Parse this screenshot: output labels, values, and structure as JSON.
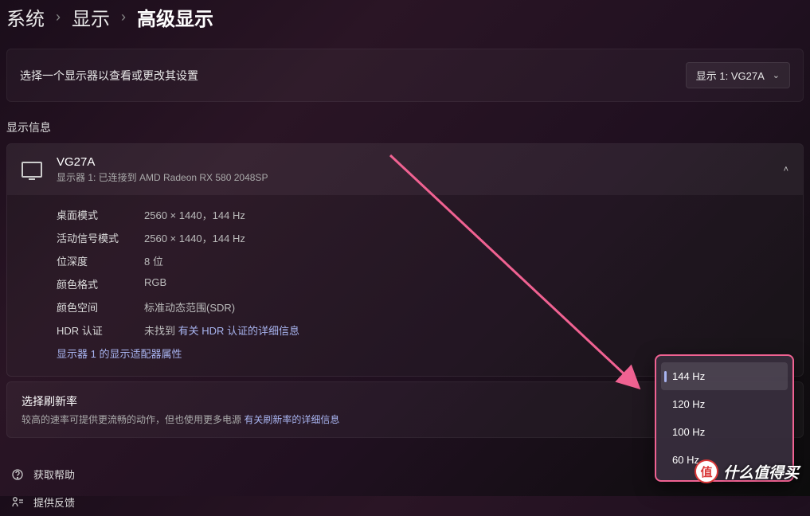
{
  "breadcrumb": {
    "system": "系统",
    "display": "显示",
    "advanced": "高级显示"
  },
  "selector": {
    "label": "选择一个显示器以查看或更改其设置",
    "dropdown_value": "显示 1: VG27A"
  },
  "section_title": "显示信息",
  "monitor": {
    "name": "VG27A",
    "subtitle": "显示器 1: 已连接到 AMD Radeon RX 580 2048SP",
    "props": {
      "desktop_mode_label": "桌面模式",
      "desktop_mode_value": "2560 × 1440，144 Hz",
      "active_signal_label": "活动信号模式",
      "active_signal_value": "2560 × 1440，144 Hz",
      "bit_depth_label": "位深度",
      "bit_depth_value": "8 位",
      "color_format_label": "颜色格式",
      "color_format_value": "RGB",
      "color_space_label": "颜色空间",
      "color_space_value": "标准动态范围(SDR)",
      "hdr_label": "HDR 认证",
      "hdr_value_prefix": "未找到 ",
      "hdr_link": "有关 HDR 认证的详细信息",
      "adapter_link": "显示器 1 的显示适配器属性"
    }
  },
  "refresh": {
    "title": "选择刷新率",
    "subtitle_prefix": "较高的速率可提供更流畅的动作，但也使用更多电源 ",
    "subtitle_link": "有关刷新率的详细信息",
    "options": [
      "144 Hz",
      "120 Hz",
      "100 Hz",
      "60 Hz"
    ],
    "selected_index": 0
  },
  "footer": {
    "help": "获取帮助",
    "feedback": "提供反馈"
  },
  "watermark": {
    "badge": "值",
    "text": "什么值得买"
  }
}
